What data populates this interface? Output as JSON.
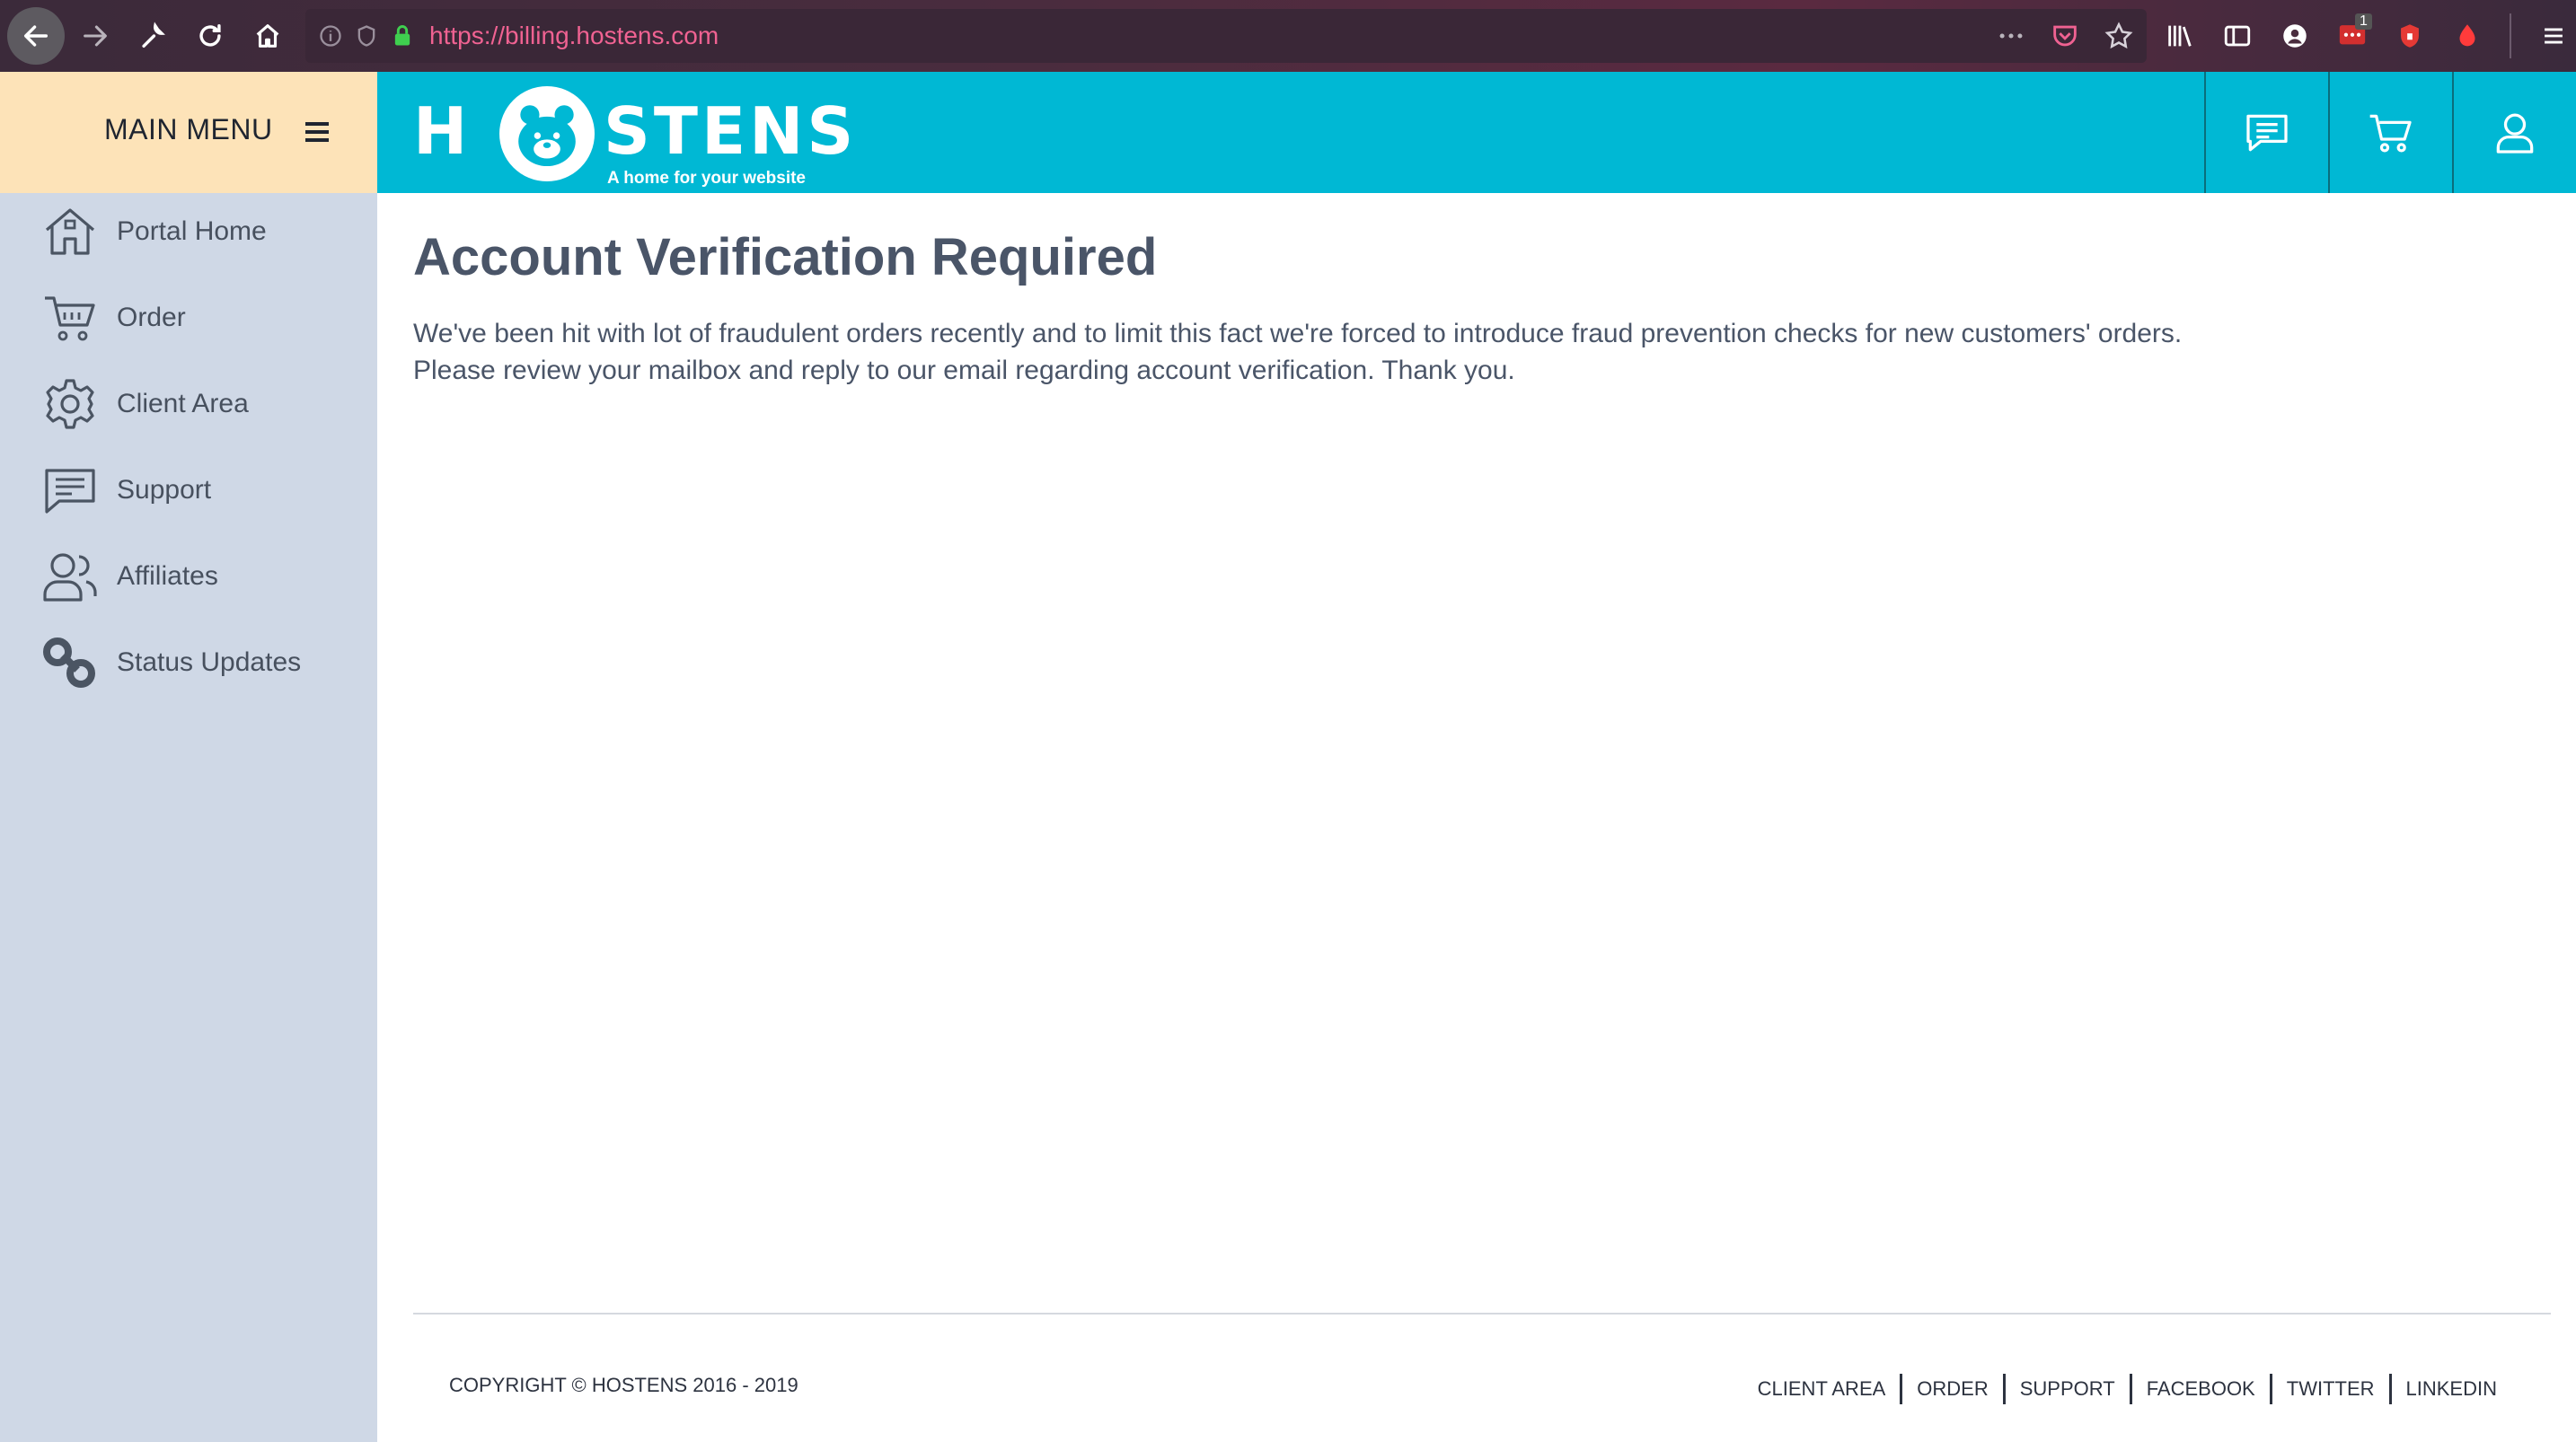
{
  "browser": {
    "url": "https://billing.hostens.com",
    "badge_count": "1"
  },
  "menu": {
    "label": "MAIN MENU"
  },
  "brand": {
    "name": "HOSTENS",
    "tagline": "A home for your website",
    "accent_color": "#00b8d4",
    "menu_bg_color": "#fde3b8",
    "sidebar_color": "#cfd8e6"
  },
  "header_icons": [
    "chat-icon",
    "cart-icon",
    "user-icon"
  ],
  "sidebar": {
    "items": [
      {
        "label": "Portal Home",
        "icon": "home-icon"
      },
      {
        "label": "Order",
        "icon": "cart-icon"
      },
      {
        "label": "Client Area",
        "icon": "gear-icon"
      },
      {
        "label": "Support",
        "icon": "chat-icon"
      },
      {
        "label": "Affiliates",
        "icon": "users-icon"
      },
      {
        "label": "Status Updates",
        "icon": "link-icon"
      }
    ]
  },
  "main": {
    "title": "Account Verification Required",
    "message_line1": "We've been hit with lot of fraudulent orders recently and to limit this fact we're forced to introduce fraud prevention checks for new customers' orders.",
    "message_line2": "Please review your mailbox and reply to our email regarding account verification. Thank you."
  },
  "footer": {
    "copyright": "COPYRIGHT © HOSTENS 2016 - 2019",
    "links": [
      "CLIENT AREA",
      "ORDER",
      "SUPPORT",
      "FACEBOOK",
      "TWITTER",
      "LINKEDIN"
    ]
  }
}
